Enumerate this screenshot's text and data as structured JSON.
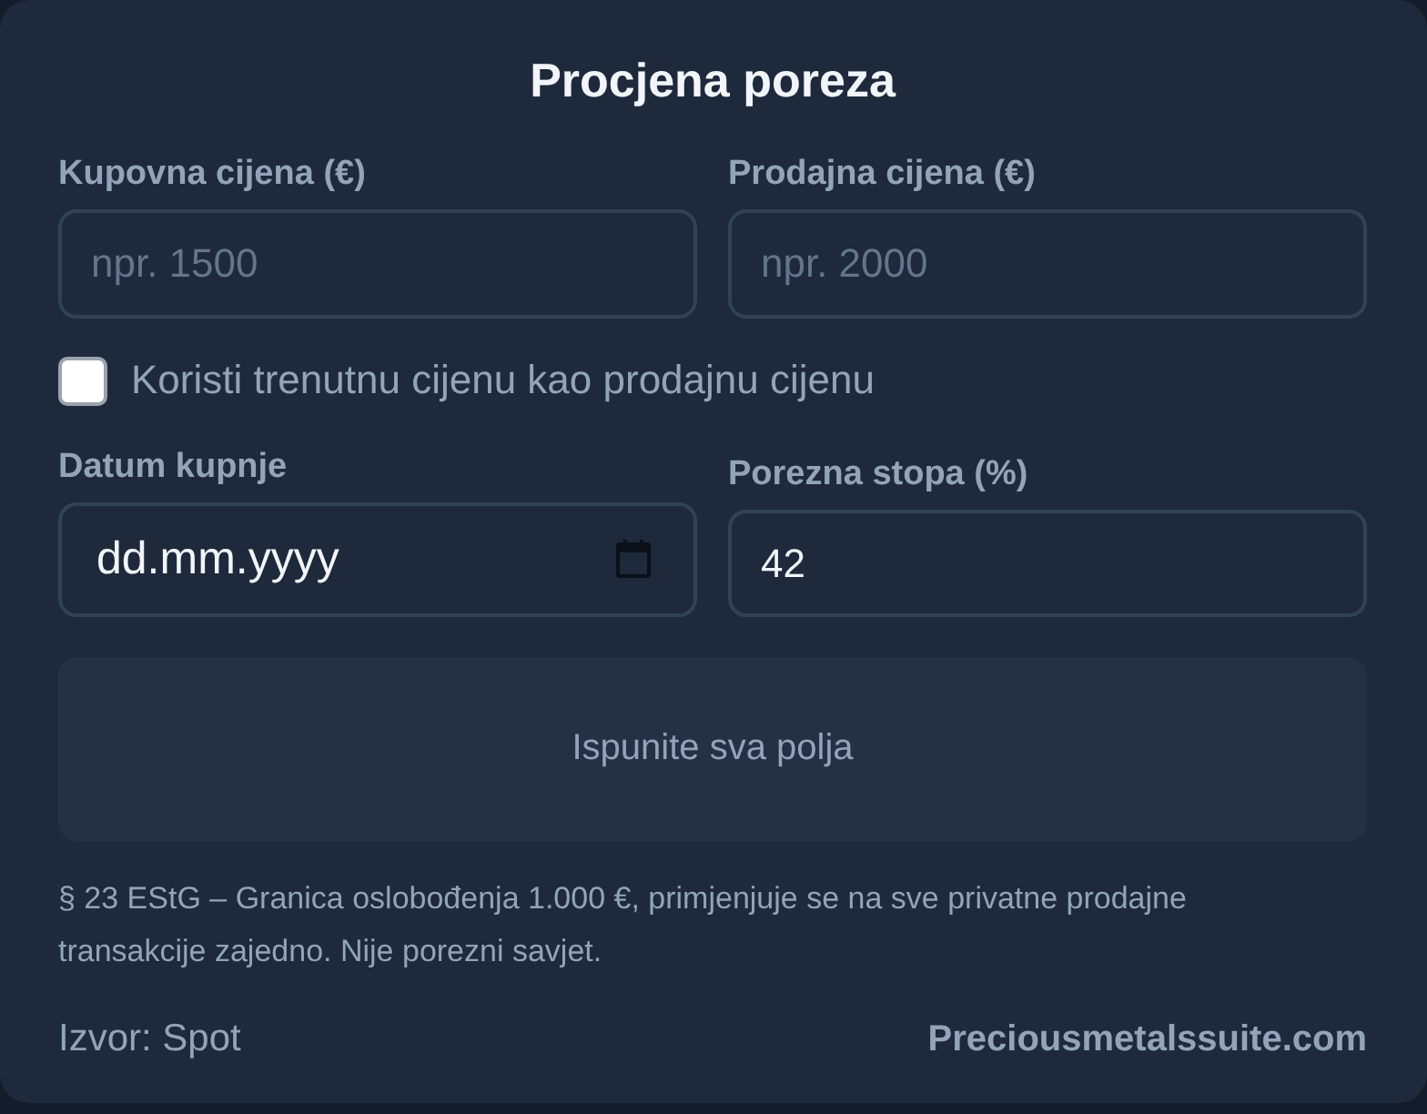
{
  "title": "Procjena poreza",
  "price_fields": [
    {
      "label": "Kupovna cijena (€)",
      "placeholder": "npr. 1500"
    },
    {
      "label": "Prodajna cijena (€)",
      "placeholder": "npr. 2000"
    }
  ],
  "use_current_price": {
    "label": "Koristi trenutnu cijenu kao prodajnu cijenu",
    "checked": false
  },
  "detail_fields": [
    {
      "kind": "date",
      "label": "Datum kupnje",
      "placeholder": "dd.mm.yyyy"
    },
    {
      "kind": "number",
      "label": "Porezna stopa (%)",
      "value": "42"
    }
  ],
  "result": {
    "message": "Ispunite sva polja"
  },
  "note": "§ 23 EStG – Granica oslobođenja 1.000 €, primjenjuje se na sve privatne prodajne transakcije zajedno. Nije porezni savjet.",
  "footer": {
    "source": "Izvor: Spot",
    "site": "Preciousmetalssuite.com"
  }
}
